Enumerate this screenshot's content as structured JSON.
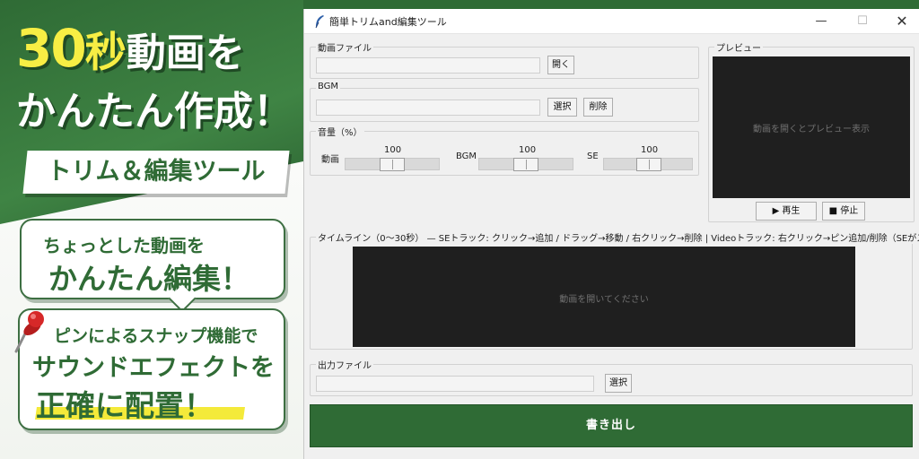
{
  "promo": {
    "headline_num": "30",
    "headline_sec": "秒",
    "headline_rest": "動画を",
    "headline_line2": "かんたん作成！",
    "banner": "トリム＆編集ツール",
    "bubble1_line1": "ちょっとした動画を",
    "bubble1_line2": "かんたん編集！",
    "bubble2_line1": "ピンによるスナップ機能で",
    "bubble2_line2": "サウンドエフェクトを",
    "bubble2_line3": "正確に配置！",
    "colors": {
      "green": "#2f6b35",
      "yellow": "#f7ee44"
    }
  },
  "window": {
    "title": "簡単トリムand編集ツール",
    "minimize": "—",
    "maximize": "☐",
    "close": "✕"
  },
  "video_file": {
    "legend": "動画ファイル",
    "value": "",
    "open_label": "開く"
  },
  "bgm": {
    "legend": "BGM",
    "value": "",
    "select_label": "選択",
    "delete_label": "削除"
  },
  "volume": {
    "legend": "音量（%）",
    "video": {
      "label": "動画",
      "value": "100",
      "level": 100
    },
    "bgm": {
      "label": "BGM",
      "value": "100",
      "level": 100
    },
    "se": {
      "label": "SE",
      "value": "100",
      "level": 100
    }
  },
  "preview": {
    "legend": "プレビュー",
    "placeholder": "動画を開くとプレビュー表示",
    "play_label": "▶ 再生",
    "stop_label": "■ 停止"
  },
  "timeline": {
    "legend": "タイムライン（0〜30秒） — SEトラック: クリック→追加 / ドラッグ→移動 / 右クリック→削除 | Videoトラック: 右クリック→ピン追加/削除（SEがスナップ）",
    "placeholder": "動画を開いてください"
  },
  "output_file": {
    "legend": "出力ファイル",
    "value": "",
    "select_label": "選択"
  },
  "export": {
    "label": "書き出し"
  }
}
